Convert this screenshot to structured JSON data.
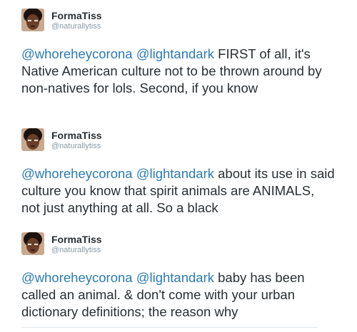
{
  "tweets": [
    {
      "user": {
        "name": "FormaTiss",
        "handle": "@naturallytiss"
      },
      "mention1": "@whoreheycorona",
      "mention2": "@lightandark",
      "text": " FIRST of all, it's Native American culture not to be thrown around by non-natives for lols. Second, if you know"
    },
    {
      "user": {
        "name": "FormaTiss",
        "handle": "@naturallytiss"
      },
      "mention1": "@whoreheycorona",
      "mention2": "@lightandark",
      "text": " about its use in said culture you know that spirit animals are ANIMALS, not just anything at all. So a black"
    },
    {
      "user": {
        "name": "FormaTiss",
        "handle": "@naturallytiss"
      },
      "mention1": "@whoreheycorona",
      "mention2": "@lightandark",
      "text": " baby has been called an animal. & don't come with your urban dictionary definitions; the reason why"
    }
  ],
  "colors": {
    "mention": "#2b7bb9",
    "text": "#292f33",
    "handle": "#8899a6"
  },
  "icons": {
    "avatar": "user-avatar-photo"
  }
}
